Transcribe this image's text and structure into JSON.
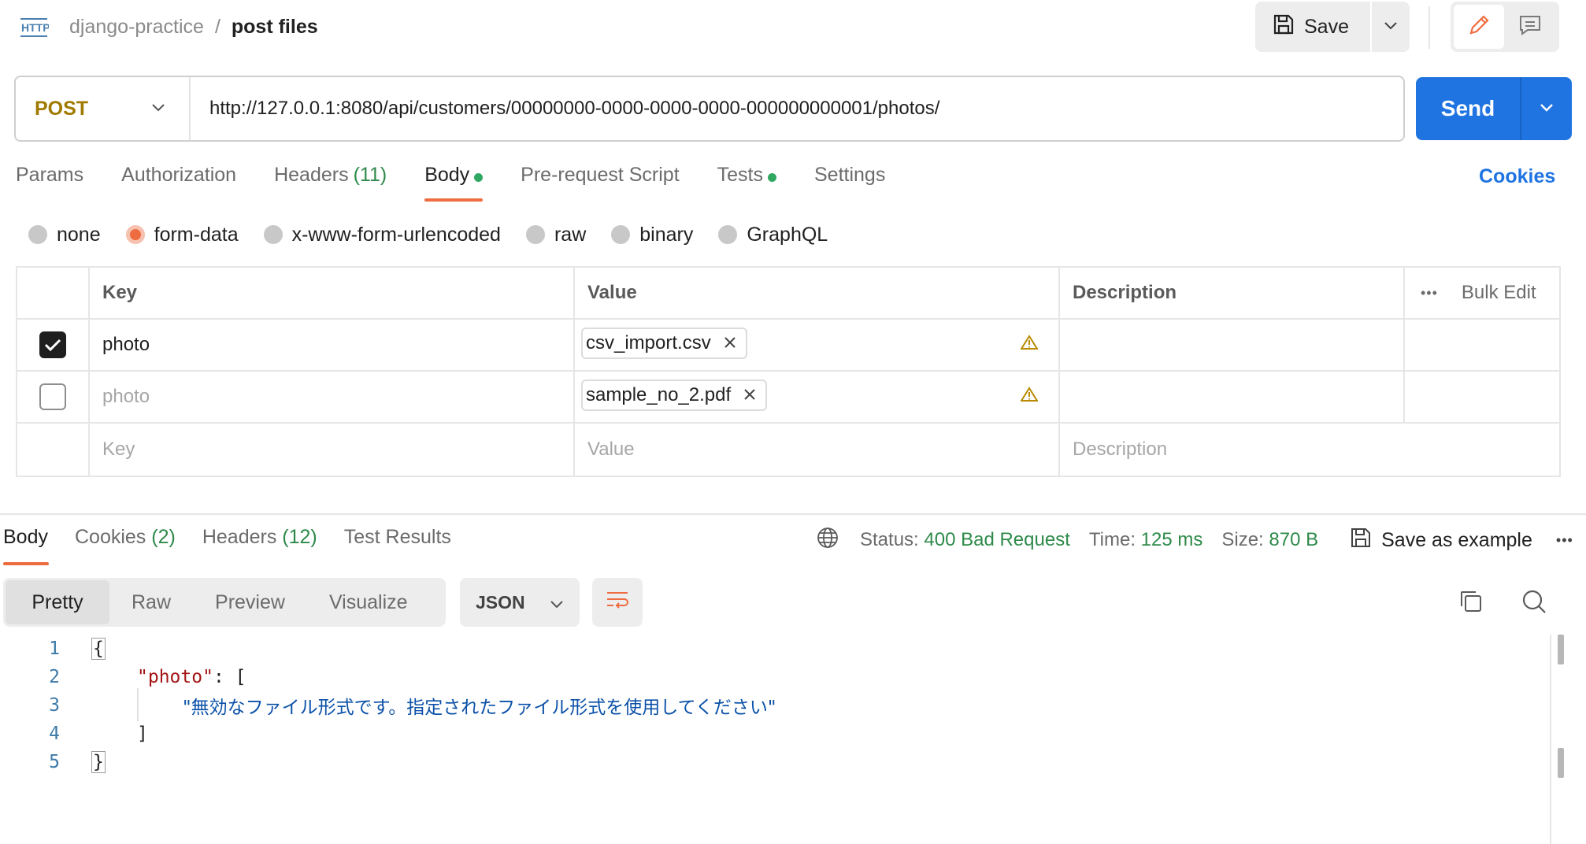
{
  "header": {
    "http_icon_label": "HTTP",
    "collection": "django-practice",
    "separator": "/",
    "request_name": "post files",
    "save_label": "Save"
  },
  "request": {
    "method": "POST",
    "url": "http://127.0.0.1:8080/api/customers/00000000-0000-0000-0000-000000000001/photos/",
    "send_label": "Send"
  },
  "request_tabs": [
    {
      "label": "Params",
      "count": "",
      "dot": false,
      "active": false
    },
    {
      "label": "Authorization",
      "count": "",
      "dot": false,
      "active": false
    },
    {
      "label": "Headers",
      "count": "(11)",
      "dot": false,
      "active": false
    },
    {
      "label": "Body",
      "count": "",
      "dot": true,
      "active": true
    },
    {
      "label": "Pre-request Script",
      "count": "",
      "dot": false,
      "active": false
    },
    {
      "label": "Tests",
      "count": "",
      "dot": true,
      "active": false
    },
    {
      "label": "Settings",
      "count": "",
      "dot": false,
      "active": false
    }
  ],
  "cookies_link": "Cookies",
  "body_modes": [
    {
      "label": "none",
      "checked": false
    },
    {
      "label": "form-data",
      "checked": true
    },
    {
      "label": "x-www-form-urlencoded",
      "checked": false
    },
    {
      "label": "raw",
      "checked": false
    },
    {
      "label": "binary",
      "checked": false
    },
    {
      "label": "GraphQL",
      "checked": false
    }
  ],
  "form_table": {
    "headers": {
      "key": "Key",
      "value": "Value",
      "description": "Description",
      "bulk_edit": "Bulk Edit",
      "more": "•••"
    },
    "rows": [
      {
        "checked": true,
        "key": "photo",
        "file": "csv_import.csv"
      },
      {
        "checked": false,
        "key": "photo",
        "file": "sample_no_2.pdf"
      }
    ],
    "placeholders": {
      "key": "Key",
      "value": "Value",
      "description": "Description"
    }
  },
  "response": {
    "tabs": [
      {
        "label": "Body",
        "count": "",
        "active": true
      },
      {
        "label": "Cookies",
        "count": "(2)",
        "active": false
      },
      {
        "label": "Headers",
        "count": "(12)",
        "active": false
      },
      {
        "label": "Test Results",
        "count": "",
        "active": false
      }
    ],
    "status_label": "Status:",
    "status_value": "400 Bad Request",
    "time_label": "Time:",
    "time_value": "125 ms",
    "size_label": "Size:",
    "size_value": "870 B",
    "save_example_label": "Save as example",
    "more": "•••",
    "formats": [
      "Pretty",
      "Raw",
      "Preview",
      "Visualize"
    ],
    "active_format": "Pretty",
    "language": "JSON",
    "code_lines": [
      {
        "num": "1",
        "open": "{"
      },
      {
        "num": "2",
        "key": "\"photo\"",
        "rest": ": ["
      },
      {
        "num": "3",
        "value": "\"無効なファイル形式です。指定されたファイル形式を使用してください\""
      },
      {
        "num": "4",
        "close": "]"
      },
      {
        "num": "5",
        "close_brace": "}"
      }
    ]
  },
  "colors": {
    "accent": "#ef6c40",
    "primary": "#1f74e1",
    "success": "#2e8a4a",
    "method": "#a07a00",
    "warning": "#b88a00"
  }
}
